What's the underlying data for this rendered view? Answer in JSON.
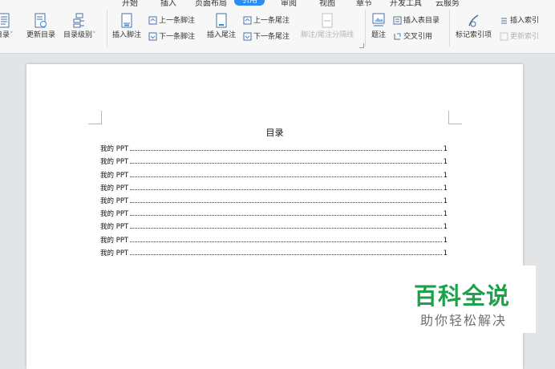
{
  "ribbon": {
    "tabs": [
      {
        "label": "开始"
      },
      {
        "label": "插入"
      },
      {
        "label": "页面布局"
      },
      {
        "label": "引用"
      },
      {
        "label": "审阅"
      },
      {
        "label": "视图"
      },
      {
        "label": "章节"
      },
      {
        "label": "开发工具"
      },
      {
        "label": "云服务"
      }
    ],
    "active_tab": "引用",
    "buttons": {
      "toc": "目录",
      "update_toc": "更新目录",
      "toc_level": "目录级别",
      "insert_footnote": "插入脚注",
      "prev_footnote": "上一条脚注",
      "next_footnote": "下一条脚注",
      "insert_endnote": "插入尾注",
      "prev_endnote": "上一条尾注",
      "next_endnote": "下一条尾注",
      "note_separator": "脚注/尾注分隔线",
      "caption": "题注",
      "insert_table_of_figures": "插入表目录",
      "cross_reference": "交叉引用",
      "mark_index_entry": "标记索引项",
      "insert_index": "插入索引",
      "update_index": "更新索引"
    }
  },
  "document": {
    "toc_title": "目录",
    "toc_entries": [
      {
        "text": "我的 PPT",
        "page": "1"
      },
      {
        "text": "我的 PPT",
        "page": "1"
      },
      {
        "text": "我的 PPT",
        "page": "1"
      },
      {
        "text": "我的 PPT",
        "page": "1"
      },
      {
        "text": "我的 PPT",
        "page": "1"
      },
      {
        "text": "我的 PPT",
        "page": "1"
      },
      {
        "text": "我的 PPT",
        "page": "1"
      },
      {
        "text": "我的 PPT",
        "page": "1"
      },
      {
        "text": "我的 PPT",
        "page": "1"
      }
    ]
  },
  "watermark": {
    "main": "百科全说",
    "sub": "助你轻松解决"
  },
  "colors": {
    "accent": "#2a8df0",
    "watermark_green": "#1fa14b",
    "ribbon_bg": "#f7f7f7",
    "canvas_bg": "#e3e4e6"
  }
}
